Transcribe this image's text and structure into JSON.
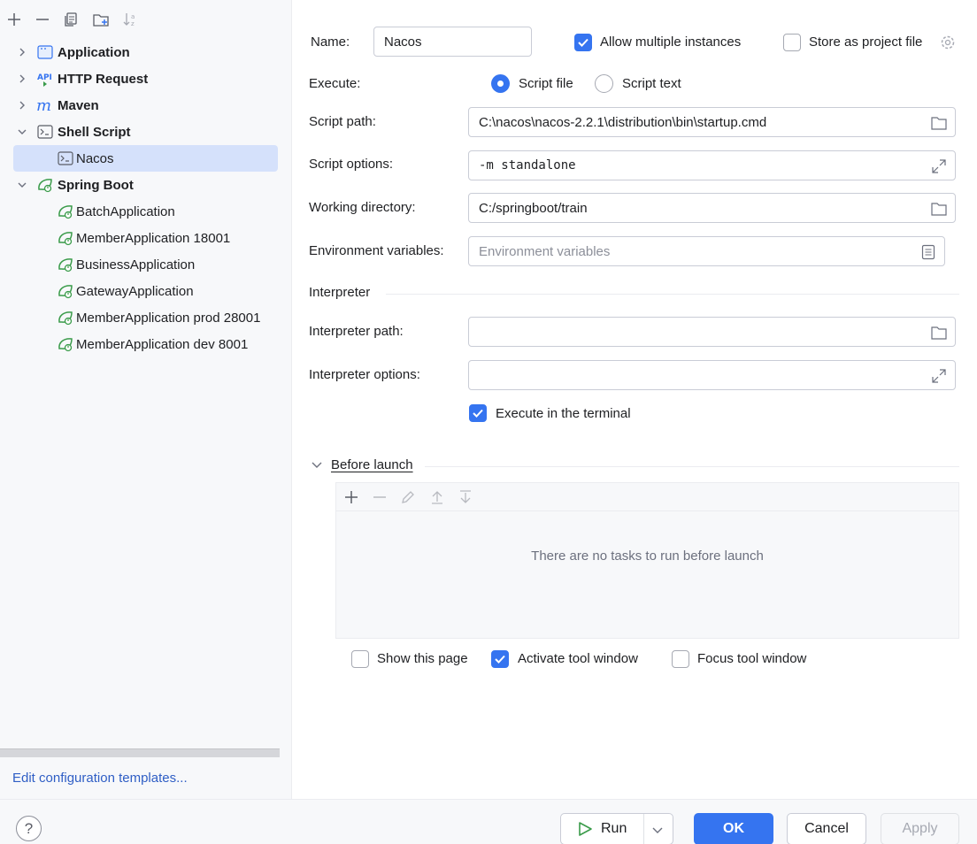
{
  "sidebar": {
    "toolbar": [
      "add-icon",
      "remove-icon",
      "copy-icon",
      "new-folder-icon",
      "sort-icon"
    ],
    "tree": {
      "application": "Application",
      "http_request": "HTTP Request",
      "maven": "Maven",
      "shell_script": "Shell Script",
      "nacos": "Nacos",
      "spring_boot": "Spring Boot",
      "spring_items": [
        "BatchApplication",
        "MemberApplication 18001",
        "BusinessApplication",
        "GatewayApplication",
        "MemberApplication prod 28001",
        "MemberApplication dev 8001"
      ]
    },
    "edit_templates": "Edit configuration templates..."
  },
  "form": {
    "name_label": "Name:",
    "name_value": "Nacos",
    "allow_multiple": {
      "label": "Allow multiple instances",
      "checked": true
    },
    "store_project": {
      "label": "Store as project file",
      "checked": false
    },
    "execute_label": "Execute:",
    "script_file": "Script file",
    "script_text": "Script text",
    "script_path_label": "Script path:",
    "script_path_value": "C:\\nacos\\nacos-2.2.1\\distribution\\bin\\startup.cmd",
    "script_options_label": "Script options:",
    "script_options_value": "-m standalone",
    "working_dir_label": "Working directory:",
    "working_dir_value": "C:/springboot/train",
    "env_vars_label": "Environment variables:",
    "env_vars_placeholder": "Environment variables",
    "interpreter_section": "Interpreter",
    "interpreter_path_label": "Interpreter path:",
    "interpreter_path_value": "",
    "interpreter_options_label": "Interpreter options:",
    "interpreter_options_value": "",
    "execute_terminal": {
      "label": "Execute in the terminal",
      "checked": true
    },
    "before_launch": "Before launch",
    "no_tasks": "There are no tasks to run before launch",
    "show_page": {
      "label": "Show this page",
      "checked": false
    },
    "activate_tool": {
      "label": "Activate tool window",
      "checked": true
    },
    "focus_tool": {
      "label": "Focus tool window",
      "checked": false
    }
  },
  "buttons": {
    "help": "?",
    "run": "Run",
    "ok": "OK",
    "cancel": "Cancel",
    "apply": "Apply"
  },
  "colors": {
    "accent": "#3574f0",
    "selection": "#d5e1fb",
    "spring_green": "#3a9b4a",
    "link": "#2f5ec5"
  }
}
